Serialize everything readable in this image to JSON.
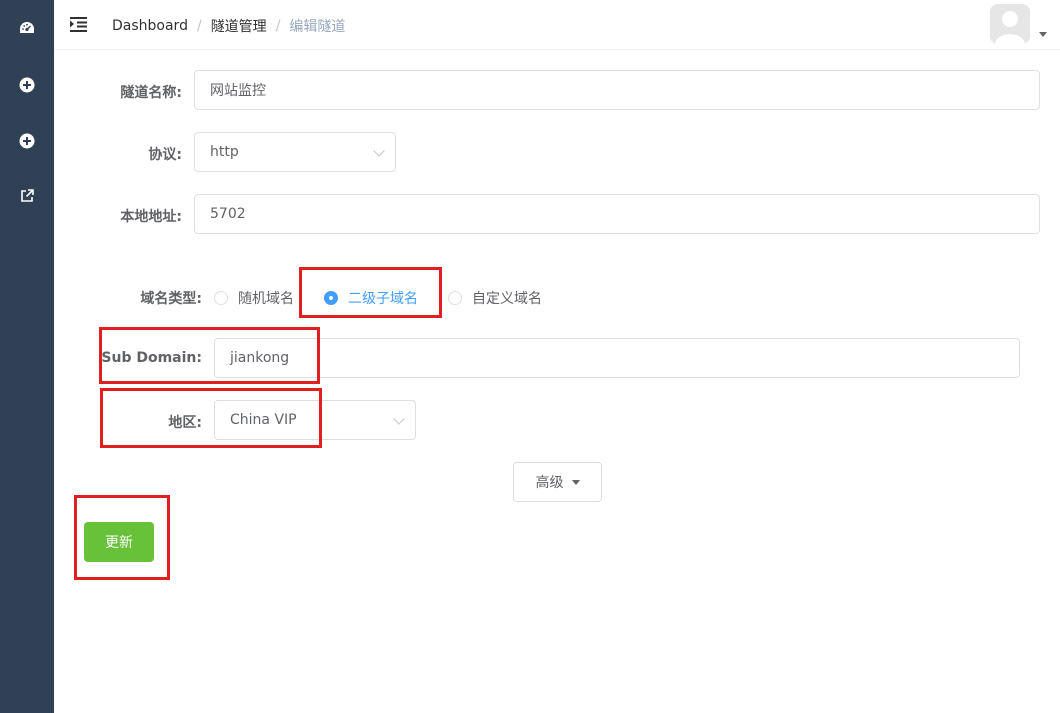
{
  "sidebar": {
    "items": [
      {
        "icon": "dashboard-icon"
      },
      {
        "icon": "plus-circle-icon"
      },
      {
        "icon": "plus-circle-icon"
      },
      {
        "icon": "external-link-icon"
      }
    ]
  },
  "header": {
    "breadcrumb": [
      "Dashboard",
      "隧道管理",
      "编辑隧道"
    ],
    "separator": "/"
  },
  "form": {
    "tunnel_name": {
      "label": "隧道名称:",
      "value": "网站监控"
    },
    "protocol": {
      "label": "协议:",
      "value": "http"
    },
    "local_address": {
      "label": "本地地址:",
      "value": "5702"
    },
    "domain_type": {
      "label": "域名类型:",
      "options": [
        "随机域名",
        "二级子域名",
        "自定义域名"
      ],
      "selected": "二级子域名"
    },
    "sub_domain": {
      "label": "Sub Domain:",
      "value": "jiankong"
    },
    "region": {
      "label": "地区:",
      "value": "China VIP"
    },
    "advanced_label": "高级",
    "update_label": "更新"
  },
  "colors": {
    "sidebar_bg": "#304156",
    "primary": "#409eff",
    "success": "#67c23a",
    "highlight": "#e02020"
  }
}
